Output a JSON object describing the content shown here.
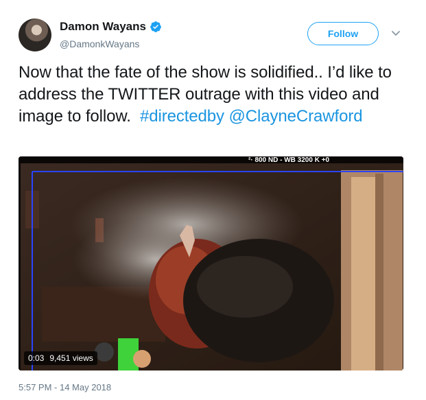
{
  "author": {
    "display_name": "Damon Wayans",
    "handle": "@DamonkWayans",
    "verified": true,
    "avatar_icon": "user-avatar"
  },
  "actions": {
    "follow_label": "Follow",
    "menu_icon": "chevron-down-icon"
  },
  "tweet": {
    "text_plain": "Now that the fate of the show is solidified.. I’d like to address the TWITTER outrage with this video and image to follow.",
    "hashtag": "#directedby",
    "mention": "@ClayneCrawford"
  },
  "media": {
    "type": "video",
    "overlay_readout": "²· 800   ND -   WB 3200 K +0",
    "time": "0:03",
    "views": "9,451 views"
  },
  "meta": {
    "timestamp": "5:57 PM - 14 May 2018"
  },
  "colors": {
    "accent": "#1da1f2",
    "link": "#1b95e0",
    "secondary_text": "#657786"
  }
}
